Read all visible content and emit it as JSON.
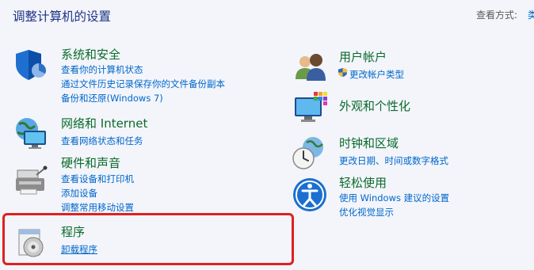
{
  "header": {
    "title": "调整计算机的设置",
    "view_by_label": "查看方式:",
    "view_by_value": "类别"
  },
  "left_categories": [
    {
      "title": "系统和安全",
      "links": [
        "查看你的计算机状态",
        "通过文件历史记录保存你的文件备份副本",
        "备份和还原(Windows 7)"
      ]
    },
    {
      "title": "网络和 Internet",
      "links": [
        "查看网络状态和任务"
      ]
    },
    {
      "title": "硬件和声音",
      "links": [
        "查看设备和打印机",
        "添加设备",
        "调整常用移动设置"
      ]
    },
    {
      "title": "程序",
      "links": [
        "卸载程序"
      ]
    }
  ],
  "right_categories": [
    {
      "title": "用户帐户",
      "links": [
        "更改帐户类型"
      ]
    },
    {
      "title": "外观和个性化",
      "links": []
    },
    {
      "title": "时钟和区域",
      "links": [
        "更改日期、时间或数字格式"
      ]
    },
    {
      "title": "轻松使用",
      "links": [
        "使用 Windows 建议的设置",
        "优化视觉显示"
      ]
    }
  ],
  "colors": {
    "background": "#f3f5fa",
    "title": "#1e3287",
    "category_title": "#0b6a2c",
    "link": "#0066cc",
    "highlight": "#e02020"
  },
  "icons": {
    "system_security": "shield-icon",
    "network": "network-globe-icon",
    "hardware": "printer-icon",
    "programs": "programs-disc-icon",
    "user_accounts": "users-icon",
    "appearance": "monitor-palette-icon",
    "clock_region": "clock-globe-icon",
    "ease_of_access": "ease-of-access-icon"
  }
}
